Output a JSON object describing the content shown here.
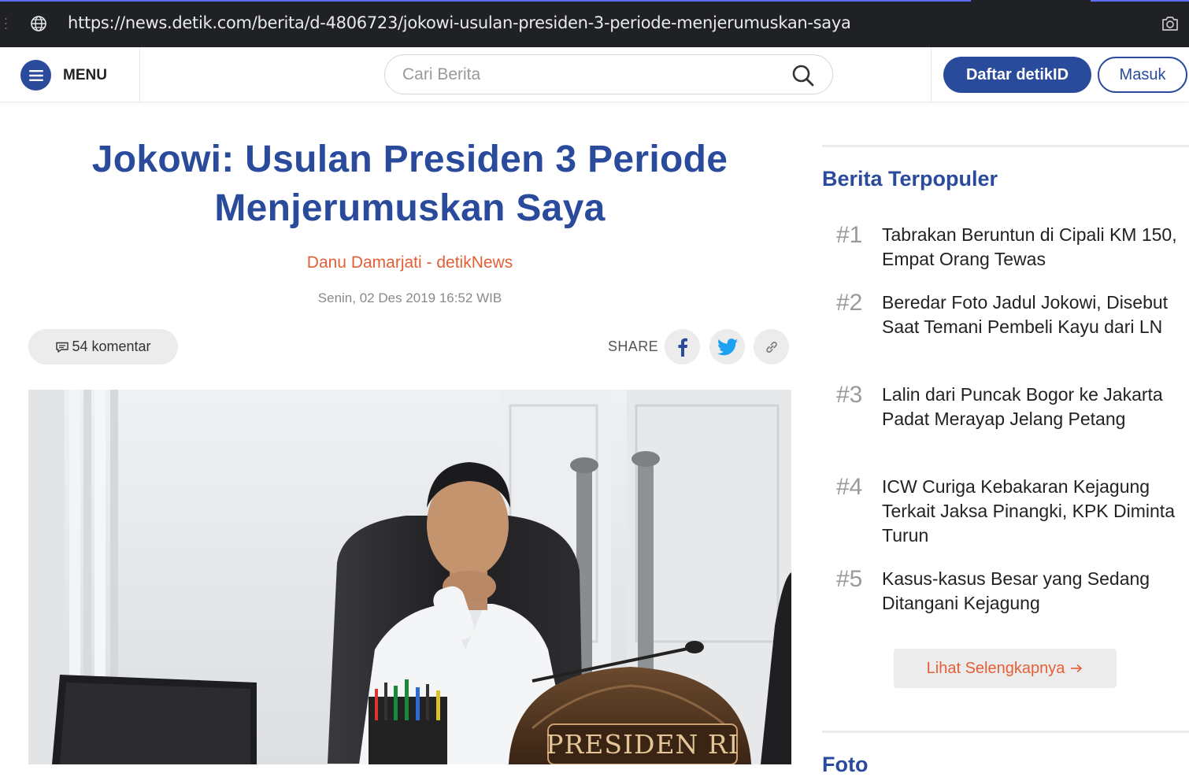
{
  "browser": {
    "url": "https://news.detik.com/berita/d-4806723/jokowi-usulan-presiden-3-periode-menjerumuskan-saya"
  },
  "header": {
    "menu_label": "MENU",
    "search_placeholder": "Cari Berita",
    "register_label": "Daftar detikID",
    "login_label": "Masuk",
    "brand_color": "#2a4a9c"
  },
  "article": {
    "title": "Jokowi: Usulan Presiden 3 Periode Menjerumuskan Saya",
    "author": "Danu Damarjati - detikNews",
    "date": "Senin, 02 Des 2019 16:52 WIB",
    "comments": "54 komentar",
    "share_label": "SHARE",
    "share_icons": [
      "facebook-icon",
      "twitter-icon",
      "link-icon"
    ],
    "photo_plate_text": "PRESIDEN RI"
  },
  "sidebar": {
    "title": "Berita Terpopuler",
    "items": [
      {
        "rank": "#1",
        "title": "Tabrakan Beruntun di Cipali KM 150, Empat Orang Tewas"
      },
      {
        "rank": "#2",
        "title": "Beredar Foto Jadul Jokowi, Disebut Saat Temani Pembeli Kayu dari LN"
      },
      {
        "rank": "#3",
        "title": "Lalin dari Puncak Bogor ke Jakarta Padat Merayap Jelang Petang"
      },
      {
        "rank": "#4",
        "title": "ICW Curiga Kebakaran Kejagung Terkait Jaksa Pinangki, KPK Diminta Turun"
      },
      {
        "rank": "#5",
        "title": "Kasus-kasus Besar yang Sedang Ditangani Kejagung"
      }
    ],
    "more_label": "Lihat Selengkapnya",
    "next_section_title": "Foto"
  }
}
